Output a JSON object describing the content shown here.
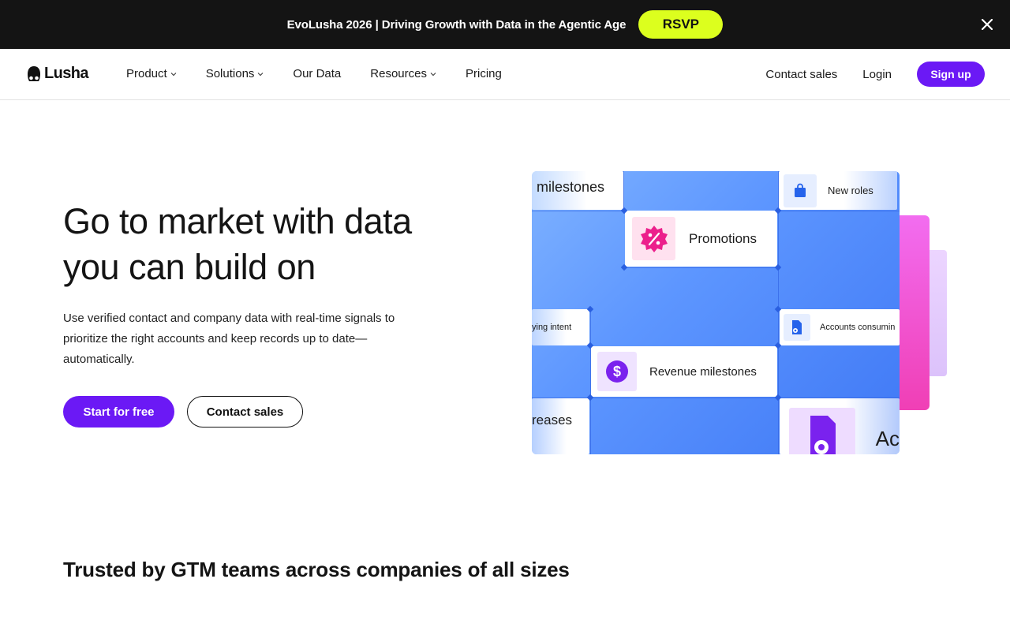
{
  "announcement": {
    "text": "EvoLusha 2026 | Driving Growth with Data in the Agentic Age",
    "cta_label": "RSVP",
    "close_icon": "close-icon"
  },
  "nav": {
    "logo_text": "Lusha",
    "items": [
      {
        "label": "Product",
        "has_dropdown": true
      },
      {
        "label": "Solutions",
        "has_dropdown": true
      },
      {
        "label": "Our Data",
        "has_dropdown": false
      },
      {
        "label": "Resources",
        "has_dropdown": true
      },
      {
        "label": "Pricing",
        "has_dropdown": false
      }
    ],
    "contact_sales": "Contact sales",
    "login": "Login",
    "signup": "Sign up"
  },
  "hero": {
    "title_line1": "Go to market with data",
    "title_line2": "you can build on",
    "subtitle": "Use verified contact and company data with real-time signals to prioritize the right accounts and keep records up to date—automatically.",
    "primary_cta": "Start for free",
    "secondary_cta": "Contact sales"
  },
  "visual": {
    "tiles": {
      "milestones": "milestones",
      "new_roles": "New roles",
      "promotions": "Promotions",
      "buying_intent": "ying intent",
      "accounts_consuming": "Accounts consumin",
      "revenue_milestones": "Revenue milestones",
      "increases": "reases",
      "ac": "Ac"
    }
  },
  "trusted": {
    "heading": "Trusted by GTM teams across companies of all sizes"
  },
  "colors": {
    "brand_purple": "#6b19f5",
    "rsvp_yellow": "#dcff1e",
    "topbar_bg": "#141414",
    "visual_blue": "#5d96ff",
    "accent_pink": "#f03fb5"
  }
}
